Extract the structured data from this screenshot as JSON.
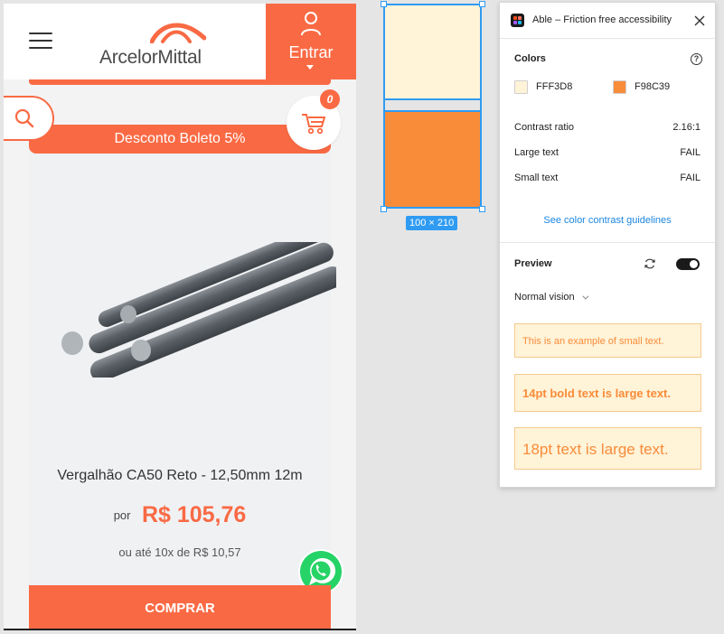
{
  "site": {
    "brand": "ArcelorMittal",
    "login_label": "Entrar",
    "cart_count": "0",
    "discount_banner": "Desconto Boleto 5%",
    "product_name": "Vergalhão CA50 Reto - 12,50mm 12m",
    "price_prefix": "por",
    "price": "R$ 105,76",
    "installments": "ou até 10x de R$ 10,57",
    "buy_label": "COMPRAR",
    "accent_color": "#f96a44"
  },
  "canvas": {
    "selection_size": "100 × 210",
    "frames": [
      {
        "color": "#FFF3D8"
      },
      {
        "color": "#F98C39"
      }
    ]
  },
  "plugin": {
    "title": "Able – Friction free accessibility",
    "colors_heading": "Colors",
    "color1": {
      "hex": "FFF3D8",
      "swatch": "#FFF3D8"
    },
    "color2": {
      "hex": "F98C39",
      "swatch": "#F98C39"
    },
    "contrast_label": "Contrast ratio",
    "contrast_value": "2.16:1",
    "large_text_label": "Large text",
    "large_text_result": "FAIL",
    "small_text_label": "Small text",
    "small_text_result": "FAIL",
    "guidelines_link": "See color contrast guidelines",
    "preview_heading": "Preview",
    "vision_mode": "Normal vision",
    "sample_small": "This is an example of small text.",
    "sample_bold": "14pt bold text is large text.",
    "sample_large": "18pt text is large text.",
    "preview_enabled": true
  }
}
